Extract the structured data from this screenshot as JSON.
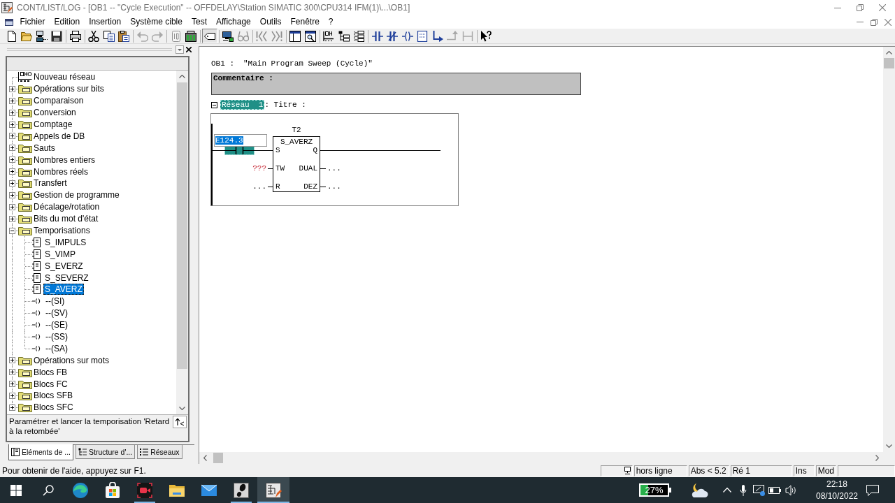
{
  "window": {
    "title": "CONT/LIST/LOG - [OB1 -- \"Cycle Execution\" -- OFFDELAY\\Station SIMATIC 300\\CPU314 IFM(1)\\...\\OB1]"
  },
  "menu": [
    "Fichier",
    "Edition",
    "Insertion",
    "Système cible",
    "Test",
    "Affichage",
    "Outils",
    "Fenêtre",
    "?"
  ],
  "toolbar": {
    "groups": [
      [
        {
          "disabled": false,
          "pressed": false
        },
        {
          "disabled": false,
          "pressed": false
        },
        {
          "disabled": false,
          "pressed": false
        },
        {
          "disabled": false,
          "pressed": false
        }
      ],
      [
        {
          "disabled": false,
          "pressed": false
        }
      ],
      [
        {
          "disabled": false,
          "pressed": false
        },
        {
          "disabled": false,
          "pressed": false
        },
        {
          "disabled": false,
          "pressed": false
        }
      ],
      [
        {
          "disabled": true,
          "pressed": false
        },
        {
          "disabled": true,
          "pressed": false
        }
      ],
      [
        {
          "disabled": true,
          "pressed": false
        },
        {
          "disabled": false,
          "pressed": false
        }
      ],
      [
        {
          "disabled": false,
          "pressed": true
        }
      ],
      [
        {
          "disabled": false,
          "pressed": false
        },
        {
          "disabled": true,
          "pressed": false
        }
      ],
      [
        {
          "disabled": true,
          "pressed": false
        },
        {
          "disabled": true,
          "pressed": false
        }
      ],
      [
        {
          "disabled": false,
          "pressed": false
        },
        {
          "disabled": false,
          "pressed": false
        }
      ],
      [
        {
          "disabled": false,
          "pressed": false
        },
        {
          "disabled": false,
          "pressed": false
        },
        {
          "disabled": false,
          "pressed": false
        }
      ],
      [
        {
          "disabled": false,
          "pressed": false
        },
        {
          "disabled": false,
          "pressed": false
        },
        {
          "disabled": false,
          "pressed": false
        },
        {
          "disabled": false,
          "pressed": false
        },
        {
          "disabled": false,
          "pressed": false
        },
        {
          "disabled": true,
          "pressed": false
        },
        {
          "disabled": true,
          "pressed": false
        }
      ],
      [
        {
          "disabled": false,
          "pressed": false
        }
      ]
    ]
  },
  "library": {
    "items": [
      {
        "label": "Nouveau réseau",
        "kind": "network",
        "selected": false
      },
      {
        "label": "Opérations sur bits",
        "kind": "folder",
        "expanded": false,
        "selected": false
      },
      {
        "label": "Comparaison",
        "kind": "folder",
        "expanded": false,
        "selected": false
      },
      {
        "label": "Conversion",
        "kind": "folder",
        "expanded": false,
        "selected": false
      },
      {
        "label": "Comptage",
        "kind": "folder",
        "expanded": false,
        "selected": false
      },
      {
        "label": "Appels de DB",
        "kind": "folder",
        "expanded": false,
        "selected": false
      },
      {
        "label": "Sauts",
        "kind": "folder",
        "expanded": false,
        "selected": false
      },
      {
        "label": "Nombres entiers",
        "kind": "folder",
        "expanded": false,
        "selected": false
      },
      {
        "label": "Nombres réels",
        "kind": "folder",
        "expanded": false,
        "selected": false
      },
      {
        "label": "Transfert",
        "kind": "folder",
        "expanded": false,
        "selected": false
      },
      {
        "label": "Gestion de programme",
        "kind": "folder",
        "expanded": false,
        "selected": false
      },
      {
        "label": "Décalage/rotation",
        "kind": "folder",
        "expanded": false,
        "selected": false
      },
      {
        "label": "Bits du mot d'état",
        "kind": "folder",
        "expanded": false,
        "selected": false
      },
      {
        "label": "Temporisations",
        "kind": "folder",
        "expanded": true,
        "selected": false,
        "children": [
          {
            "label": "S_IMPULS",
            "kind": "box",
            "selected": false
          },
          {
            "label": "S_VIMP",
            "kind": "box",
            "selected": false
          },
          {
            "label": "S_EVERZ",
            "kind": "box",
            "selected": false
          },
          {
            "label": "S_SEVERZ",
            "kind": "box",
            "selected": false
          },
          {
            "label": "S_AVERZ",
            "kind": "box",
            "selected": true
          },
          {
            "label": "--(SI)",
            "kind": "coil",
            "selected": false
          },
          {
            "label": "--(SV)",
            "kind": "coil",
            "selected": false
          },
          {
            "label": "--(SE)",
            "kind": "coil",
            "selected": false
          },
          {
            "label": "--(SS)",
            "kind": "coil",
            "selected": false
          },
          {
            "label": "--(SA)",
            "kind": "coil",
            "selected": false
          }
        ]
      },
      {
        "label": "Opérations sur mots",
        "kind": "folder",
        "expanded": false,
        "selected": false
      },
      {
        "label": "Blocs FB",
        "kind": "folder",
        "expanded": false,
        "selected": false
      },
      {
        "label": "Blocs FC",
        "kind": "folder",
        "expanded": false,
        "selected": false
      },
      {
        "label": "Blocs SFB",
        "kind": "folder",
        "expanded": false,
        "selected": false
      },
      {
        "label": "Blocs SFC",
        "kind": "folder",
        "expanded": false,
        "selected": false
      }
    ],
    "description": "Paramétrer et lancer la temporisation 'Retard à la retombée'",
    "tabs": [
      {
        "label": "Eléments de ...",
        "selected": true
      },
      {
        "label": "Structure d'...",
        "selected": false
      },
      {
        "label": "Réseaux",
        "selected": false
      }
    ]
  },
  "editor": {
    "block": "OB1 :",
    "block_name": "\"Main Program Sweep (Cycle)\"",
    "comment_label": "Commentaire :",
    "networks": [
      {
        "label": "Réseau  1",
        "selected": true,
        "expanded": true,
        "title_label": ": Titre :",
        "contact": {
          "address": "E124.3",
          "selected": true,
          "address_selected": true
        },
        "timer": {
          "name": "T2",
          "type": "S_AVERZ",
          "inputs": [
            {
              "pin": "S"
            },
            {
              "pin": "TW",
              "value": "???",
              "missing": true
            },
            {
              "pin": "R",
              "value": "...",
              "missing": false
            }
          ],
          "outputs": [
            {
              "pin": "Q"
            },
            {
              "pin": "DUAL",
              "value": "..."
            },
            {
              "pin": "DEZ",
              "value": "..."
            }
          ]
        }
      }
    ]
  },
  "status_bar": {
    "message": "Pour obtenir de l'aide, appuyez sur F1.",
    "panels": [
      "hors ligne",
      "Abs < 5.2",
      "Ré 1",
      "Ins",
      "Mod"
    ]
  },
  "taskbar": {
    "apps": [
      {
        "running": false,
        "selected": false
      },
      {
        "running": false,
        "selected": false
      },
      {
        "running": true,
        "selected": false
      },
      {
        "running": false,
        "selected": false
      },
      {
        "running": false,
        "selected": false
      },
      {
        "running": true,
        "selected": false
      },
      {
        "running": true,
        "selected": true
      }
    ],
    "battery_widget": {
      "text": "27%",
      "level": 0.27
    },
    "clock": {
      "time": "22:18",
      "date": "08/10/2022"
    }
  }
}
